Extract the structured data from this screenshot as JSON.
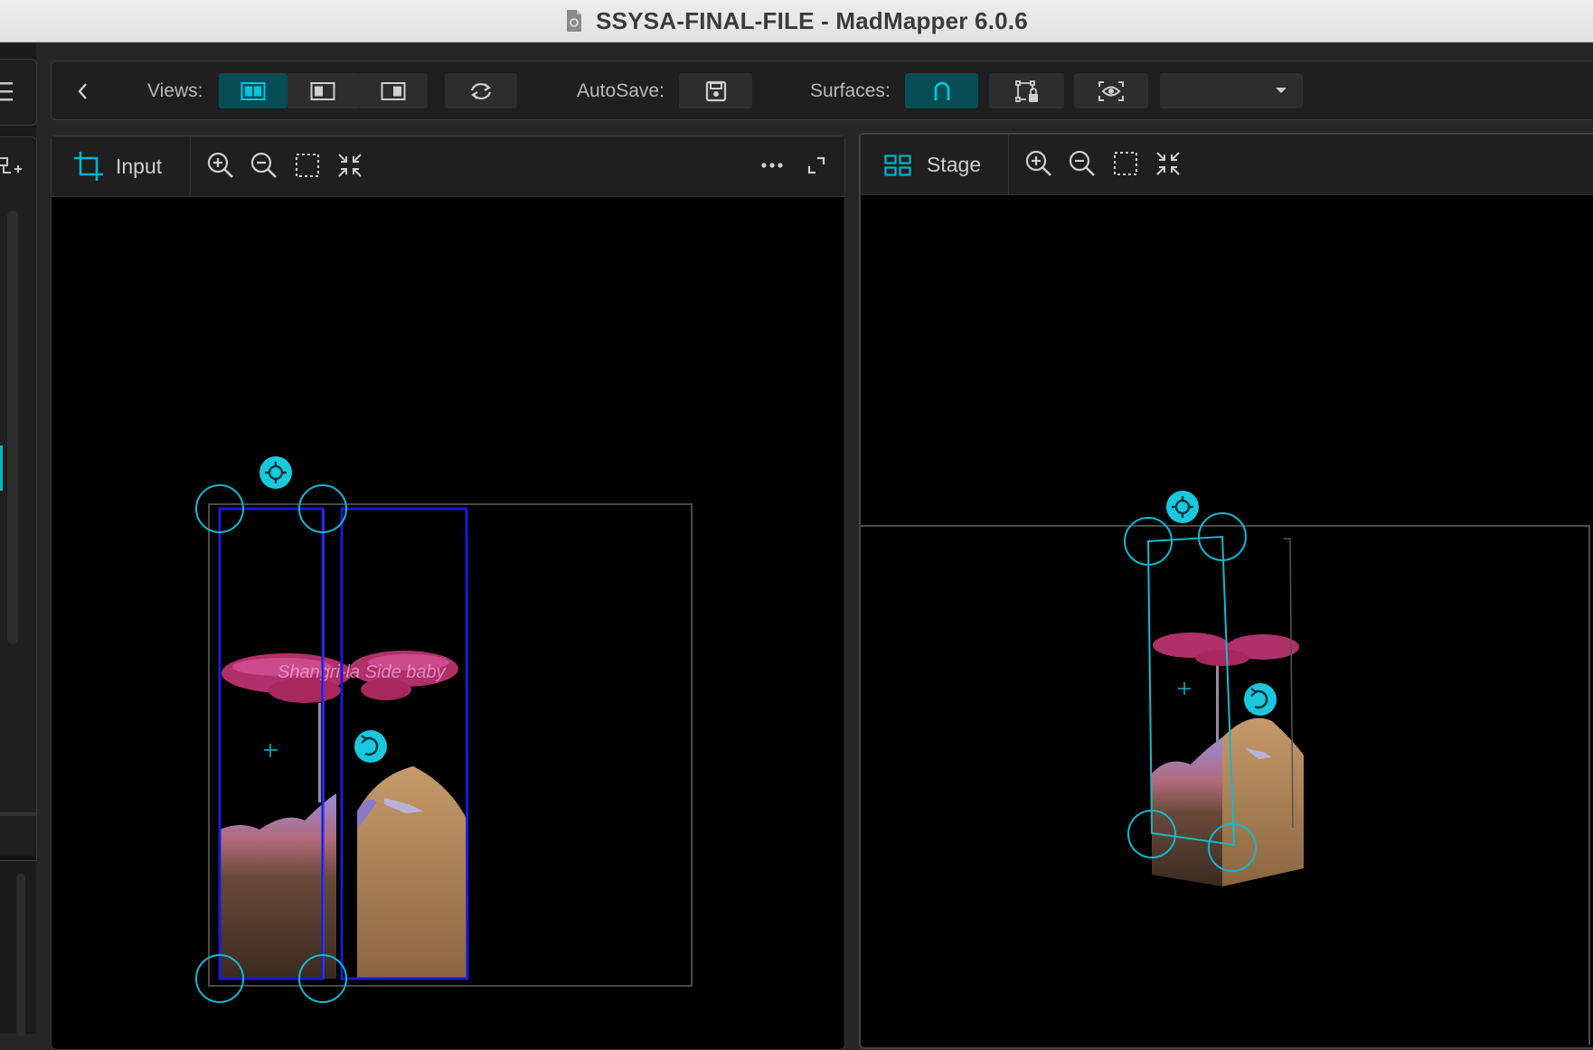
{
  "window": {
    "title": "SSYSA-FINAL-FILE - MadMapper 6.0.6"
  },
  "toolbar": {
    "views_label": "Views:",
    "autosave_label": "AutoSave:",
    "surfaces_label": "Surfaces:",
    "dropdown_value": ""
  },
  "input_panel": {
    "title": "Input"
  },
  "stage_panel": {
    "title": "Stage"
  },
  "colors": {
    "accent": "#00c8dc",
    "active_bg": "#064d55",
    "surface_outline": "#1a1ad8",
    "stage_outline": "#18b8c8"
  },
  "artwork": {
    "sign_text": "Shangri-la Side baby"
  }
}
